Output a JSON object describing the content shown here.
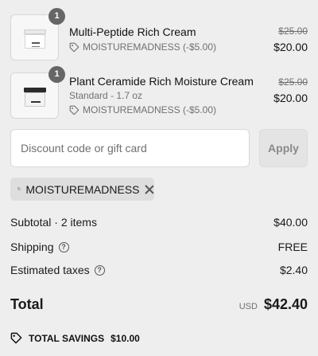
{
  "items": [
    {
      "quantity": "1",
      "name": "Multi-Peptide Rich Cream",
      "variant": "",
      "discount": "MOISTUREMADNESS (-$5.00)",
      "original_price": "$25.00",
      "final_price": "$20.00"
    },
    {
      "quantity": "1",
      "name": "Plant Ceramide Rich Moisture Cream",
      "variant": "Standard - 1.7 oz",
      "discount": "MOISTUREMADNESS (-$5.00)",
      "original_price": "$25.00",
      "final_price": "$20.00"
    }
  ],
  "discount": {
    "placeholder": "Discount code or gift card",
    "apply_label": "Apply",
    "applied_code": "MOISTUREMADNESS"
  },
  "summary": {
    "subtotal_label": "Subtotal · 2 items",
    "subtotal_value": "$40.00",
    "shipping_label": "Shipping",
    "shipping_value": "FREE",
    "taxes_label": "Estimated taxes",
    "taxes_value": "$2.40",
    "total_label": "Total",
    "currency": "USD",
    "total_value": "$42.40",
    "savings_label": "TOTAL SAVINGS",
    "savings_value": "$10.00"
  },
  "icons": {
    "tag": "tag-icon",
    "help": "question-circle-icon",
    "remove": "close-icon"
  }
}
